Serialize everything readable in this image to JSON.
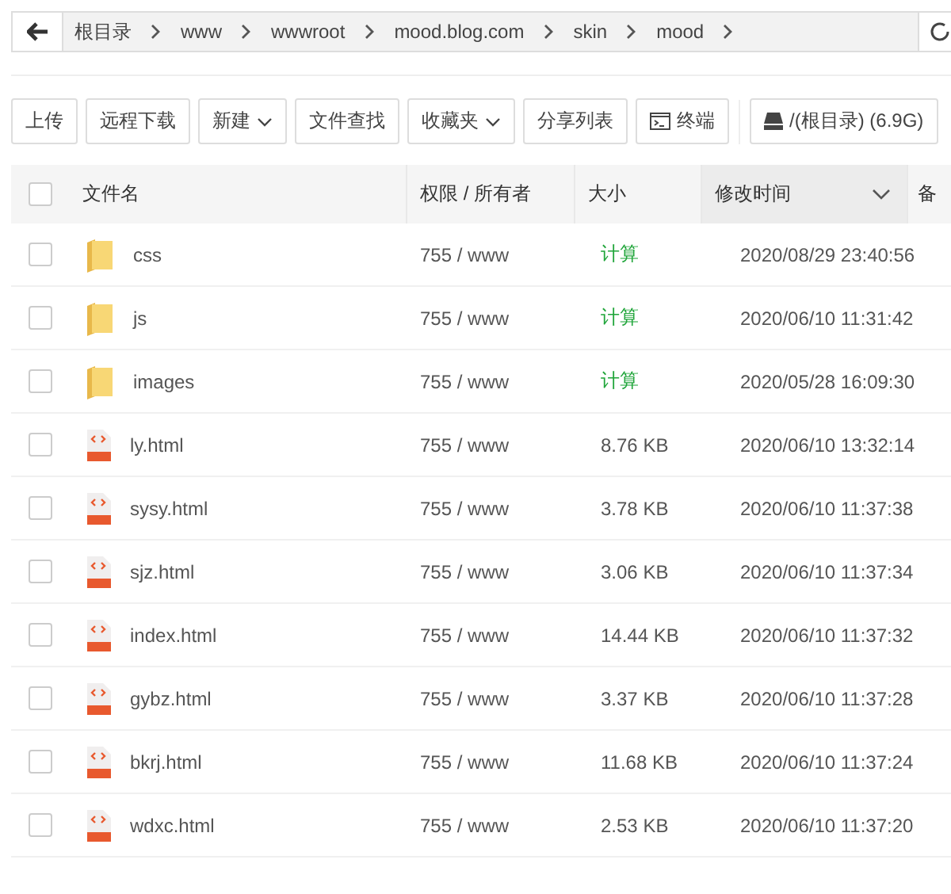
{
  "breadcrumb": [
    "根目录",
    "www",
    "wwwroot",
    "mood.blog.com",
    "skin",
    "mood"
  ],
  "toolbar": [
    {
      "label": "上传",
      "kind": "plain"
    },
    {
      "label": "远程下载",
      "kind": "plain"
    },
    {
      "label": "新建",
      "kind": "dropdown"
    },
    {
      "label": "文件查找",
      "kind": "plain"
    },
    {
      "label": "收藏夹",
      "kind": "dropdown"
    },
    {
      "label": "分享列表",
      "kind": "plain"
    },
    {
      "label": "终端",
      "kind": "terminal"
    },
    {
      "label": "/(根目录) (6.9G)",
      "kind": "disk"
    }
  ],
  "table": {
    "all_checked": false,
    "columns": [
      {
        "label": "文件名",
        "sorted": false
      },
      {
        "label": "权限 / 所有者",
        "sorted": false
      },
      {
        "label": "大小",
        "sorted": false
      },
      {
        "label": "修改时间",
        "sorted": true
      },
      {
        "label": "备",
        "sorted": false
      }
    ],
    "rows": [
      {
        "kind": "folder",
        "name": "css",
        "perm": "755 / www",
        "size": "计算",
        "time": "2020/08/29 23:40:56",
        "checked": false
      },
      {
        "kind": "folder",
        "name": "js",
        "perm": "755 / www",
        "size": "计算",
        "time": "2020/06/10 11:31:42",
        "checked": false
      },
      {
        "kind": "folder",
        "name": "images",
        "perm": "755 / www",
        "size": "计算",
        "time": "2020/05/28 16:09:30",
        "checked": false
      },
      {
        "kind": "html",
        "name": "ly.html",
        "perm": "755 / www",
        "size": "8.76 KB",
        "time": "2020/06/10 13:32:14",
        "checked": false
      },
      {
        "kind": "html",
        "name": "sysy.html",
        "perm": "755 / www",
        "size": "3.78 KB",
        "time": "2020/06/10 11:37:38",
        "checked": false
      },
      {
        "kind": "html",
        "name": "sjz.html",
        "perm": "755 / www",
        "size": "3.06 KB",
        "time": "2020/06/10 11:37:34",
        "checked": false
      },
      {
        "kind": "html",
        "name": "index.html",
        "perm": "755 / www",
        "size": "14.44 KB",
        "time": "2020/06/10 11:37:32",
        "checked": false
      },
      {
        "kind": "html",
        "name": "gybz.html",
        "perm": "755 / www",
        "size": "3.37 KB",
        "time": "2020/06/10 11:37:28",
        "checked": false
      },
      {
        "kind": "html",
        "name": "bkrj.html",
        "perm": "755 / www",
        "size": "11.68 KB",
        "time": "2020/06/10 11:37:24",
        "checked": false
      },
      {
        "kind": "html",
        "name": "wdxc.html",
        "perm": "755 / www",
        "size": "2.53 KB",
        "time": "2020/06/10 11:37:20",
        "checked": false
      }
    ]
  }
}
